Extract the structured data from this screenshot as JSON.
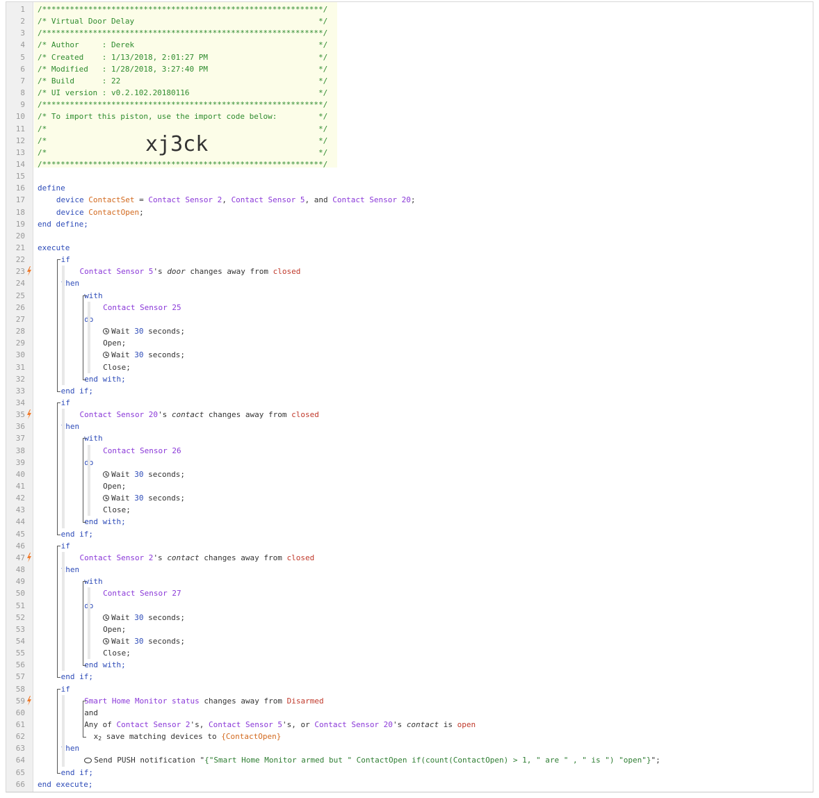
{
  "lines": [
    {
      "segs": [
        {
          "t": "/*************************************************************/",
          "c": "com"
        }
      ]
    },
    {
      "segs": [
        {
          "t": "/* Virtual Door Delay                                        */",
          "c": "com"
        }
      ]
    },
    {
      "segs": [
        {
          "t": "/*************************************************************/",
          "c": "com"
        }
      ]
    },
    {
      "segs": [
        {
          "t": "/* Author     : Derek                                        */",
          "c": "com"
        }
      ]
    },
    {
      "segs": [
        {
          "t": "/* Created    : 1/13/2018, 2:01:27 PM                        */",
          "c": "com"
        }
      ]
    },
    {
      "segs": [
        {
          "t": "/* Modified   : 1/28/2018, 3:27:40 PM                        */",
          "c": "com"
        }
      ]
    },
    {
      "segs": [
        {
          "t": "/* Build      : 22                                           */",
          "c": "com"
        }
      ]
    },
    {
      "segs": [
        {
          "t": "/* UI version : v0.2.102.20180116                            */",
          "c": "com"
        }
      ]
    },
    {
      "segs": [
        {
          "t": "/*************************************************************/",
          "c": "com"
        }
      ]
    },
    {
      "segs": [
        {
          "t": "/* To import this piston, use the import code below:         */",
          "c": "com"
        }
      ]
    },
    {
      "segs": [
        {
          "t": "/*                                                           */",
          "c": "com"
        }
      ]
    },
    {
      "segs": [
        {
          "t": "/*                                                           */",
          "c": "com"
        }
      ]
    },
    {
      "segs": [
        {
          "t": "/*                                                           */",
          "c": "com"
        }
      ]
    },
    {
      "segs": [
        {
          "t": "/*************************************************************/",
          "c": "com"
        }
      ]
    },
    {
      "segs": []
    },
    {
      "segs": [
        {
          "t": "define",
          "c": "kw"
        }
      ]
    },
    {
      "indent": 4,
      "segs": [
        {
          "t": "device ",
          "c": "kw"
        },
        {
          "t": "ContactSet",
          "c": "var"
        },
        {
          "t": " = ",
          "c": "txt"
        },
        {
          "t": "Contact Sensor 2",
          "c": "dev"
        },
        {
          "t": ", ",
          "c": "txt"
        },
        {
          "t": "Contact Sensor 5",
          "c": "dev"
        },
        {
          "t": ", and ",
          "c": "txt"
        },
        {
          "t": "Contact Sensor 20",
          "c": "dev"
        },
        {
          "t": ";",
          "c": "txt"
        }
      ]
    },
    {
      "indent": 4,
      "segs": [
        {
          "t": "device ",
          "c": "kw"
        },
        {
          "t": "ContactOpen",
          "c": "var"
        },
        {
          "t": ";",
          "c": "txt"
        }
      ]
    },
    {
      "segs": [
        {
          "t": "end define;",
          "c": "kw"
        }
      ]
    },
    {
      "segs": []
    },
    {
      "segs": [
        {
          "t": "execute",
          "c": "kw"
        }
      ]
    },
    {
      "indent": 5,
      "segs": [
        {
          "t": "if",
          "c": "kw"
        }
      ]
    },
    {
      "indent": 9,
      "bolt": true,
      "segs": [
        {
          "t": "Contact Sensor 5",
          "c": "dev"
        },
        {
          "t": "'s ",
          "c": "txt"
        },
        {
          "t": "door",
          "c": "it"
        },
        {
          "t": " changes away from ",
          "c": "txt"
        },
        {
          "t": "closed",
          "c": "val"
        }
      ]
    },
    {
      "indent": 5,
      "segs": [
        {
          "t": "then",
          "c": "kw"
        }
      ]
    },
    {
      "indent": 10,
      "segs": [
        {
          "t": "with",
          "c": "kw"
        }
      ]
    },
    {
      "indent": 14,
      "segs": [
        {
          "t": "Contact Sensor 25",
          "c": "dev"
        }
      ]
    },
    {
      "indent": 10,
      "segs": [
        {
          "t": "do",
          "c": "kw"
        }
      ]
    },
    {
      "indent": 14,
      "clock": true,
      "segs": [
        {
          "t": "Wait ",
          "c": "txt"
        },
        {
          "t": "30",
          "c": "num"
        },
        {
          "t": " seconds;",
          "c": "txt"
        }
      ]
    },
    {
      "indent": 14,
      "segs": [
        {
          "t": "Open;",
          "c": "txt"
        }
      ]
    },
    {
      "indent": 14,
      "clock": true,
      "segs": [
        {
          "t": "Wait ",
          "c": "txt"
        },
        {
          "t": "30",
          "c": "num"
        },
        {
          "t": " seconds;",
          "c": "txt"
        }
      ]
    },
    {
      "indent": 14,
      "segs": [
        {
          "t": "Close;",
          "c": "txt"
        }
      ]
    },
    {
      "indent": 10,
      "segs": [
        {
          "t": "end with;",
          "c": "kw"
        }
      ]
    },
    {
      "indent": 5,
      "segs": [
        {
          "t": "end if;",
          "c": "kw"
        }
      ]
    },
    {
      "indent": 5,
      "segs": [
        {
          "t": "if",
          "c": "kw"
        }
      ]
    },
    {
      "indent": 9,
      "bolt": true,
      "segs": [
        {
          "t": "Contact Sensor 20",
          "c": "dev"
        },
        {
          "t": "'s ",
          "c": "txt"
        },
        {
          "t": "contact",
          "c": "it"
        },
        {
          "t": " changes away from ",
          "c": "txt"
        },
        {
          "t": "closed",
          "c": "val"
        }
      ]
    },
    {
      "indent": 5,
      "segs": [
        {
          "t": "then",
          "c": "kw"
        }
      ]
    },
    {
      "indent": 10,
      "segs": [
        {
          "t": "with",
          "c": "kw"
        }
      ]
    },
    {
      "indent": 14,
      "segs": [
        {
          "t": "Contact Sensor 26",
          "c": "dev"
        }
      ]
    },
    {
      "indent": 10,
      "segs": [
        {
          "t": "do",
          "c": "kw"
        }
      ]
    },
    {
      "indent": 14,
      "clock": true,
      "segs": [
        {
          "t": "Wait ",
          "c": "txt"
        },
        {
          "t": "30",
          "c": "num"
        },
        {
          "t": " seconds;",
          "c": "txt"
        }
      ]
    },
    {
      "indent": 14,
      "segs": [
        {
          "t": "Open;",
          "c": "txt"
        }
      ]
    },
    {
      "indent": 14,
      "clock": true,
      "segs": [
        {
          "t": "Wait ",
          "c": "txt"
        },
        {
          "t": "30",
          "c": "num"
        },
        {
          "t": " seconds;",
          "c": "txt"
        }
      ]
    },
    {
      "indent": 14,
      "segs": [
        {
          "t": "Close;",
          "c": "txt"
        }
      ]
    },
    {
      "indent": 10,
      "segs": [
        {
          "t": "end with;",
          "c": "kw"
        }
      ]
    },
    {
      "indent": 5,
      "segs": [
        {
          "t": "end if;",
          "c": "kw"
        }
      ]
    },
    {
      "indent": 5,
      "segs": [
        {
          "t": "if",
          "c": "kw"
        }
      ]
    },
    {
      "indent": 9,
      "bolt": true,
      "segs": [
        {
          "t": "Contact Sensor 2",
          "c": "dev"
        },
        {
          "t": "'s ",
          "c": "txt"
        },
        {
          "t": "contact",
          "c": "it"
        },
        {
          "t": " changes away from ",
          "c": "txt"
        },
        {
          "t": "closed",
          "c": "val"
        }
      ]
    },
    {
      "indent": 5,
      "segs": [
        {
          "t": "then",
          "c": "kw"
        }
      ]
    },
    {
      "indent": 10,
      "segs": [
        {
          "t": "with",
          "c": "kw"
        }
      ]
    },
    {
      "indent": 14,
      "segs": [
        {
          "t": "Contact Sensor 27",
          "c": "dev"
        }
      ]
    },
    {
      "indent": 10,
      "segs": [
        {
          "t": "do",
          "c": "kw"
        }
      ]
    },
    {
      "indent": 14,
      "clock": true,
      "segs": [
        {
          "t": "Wait ",
          "c": "txt"
        },
        {
          "t": "30",
          "c": "num"
        },
        {
          "t": " seconds;",
          "c": "txt"
        }
      ]
    },
    {
      "indent": 14,
      "segs": [
        {
          "t": "Open;",
          "c": "txt"
        }
      ]
    },
    {
      "indent": 14,
      "clock": true,
      "segs": [
        {
          "t": "Wait ",
          "c": "txt"
        },
        {
          "t": "30",
          "c": "num"
        },
        {
          "t": " seconds;",
          "c": "txt"
        }
      ]
    },
    {
      "indent": 14,
      "segs": [
        {
          "t": "Close;",
          "c": "txt"
        }
      ]
    },
    {
      "indent": 10,
      "segs": [
        {
          "t": "end with;",
          "c": "kw"
        }
      ]
    },
    {
      "indent": 5,
      "segs": [
        {
          "t": "end if;",
          "c": "kw"
        }
      ]
    },
    {
      "indent": 5,
      "segs": [
        {
          "t": "if",
          "c": "kw"
        }
      ]
    },
    {
      "indent": 10,
      "bolt": true,
      "segs": [
        {
          "t": "Smart Home Monitor status",
          "c": "dev"
        },
        {
          "t": " changes away from ",
          "c": "txt"
        },
        {
          "t": "Disarmed",
          "c": "val"
        }
      ]
    },
    {
      "indent": 10,
      "segs": [
        {
          "t": "and",
          "c": "txt"
        }
      ]
    },
    {
      "indent": 10,
      "segs": [
        {
          "t": "Any of ",
          "c": "txt"
        },
        {
          "t": "Contact Sensor 2",
          "c": "dev"
        },
        {
          "t": "'s, ",
          "c": "txt"
        },
        {
          "t": "Contact Sensor 5",
          "c": "dev"
        },
        {
          "t": "'s, or ",
          "c": "txt"
        },
        {
          "t": "Contact Sensor 20",
          "c": "dev"
        },
        {
          "t": "'s ",
          "c": "txt"
        },
        {
          "t": "contact",
          "c": "it"
        },
        {
          "t": " is ",
          "c": "txt"
        },
        {
          "t": "open",
          "c": "val"
        }
      ]
    },
    {
      "indent": 12,
      "segs": [
        {
          "t": "x",
          "c": "txt"
        },
        {
          "t": "2",
          "c": "sub"
        },
        {
          "t": " save matching devices to ",
          "c": "txt"
        },
        {
          "t": "{ContactOpen}",
          "c": "var"
        }
      ]
    },
    {
      "indent": 5,
      "segs": [
        {
          "t": "then",
          "c": "kw"
        }
      ]
    },
    {
      "indent": 10,
      "bubble": true,
      "segs": [
        {
          "t": "Send PUSH notification \"",
          "c": "txt"
        },
        {
          "t": "{\"Smart Home Monitor armed but \" ContactOpen if(count(ContactOpen) > 1, \" are \" , \" is \") \"open\"}",
          "c": "str"
        },
        {
          "t": "\";",
          "c": "txt"
        }
      ]
    },
    {
      "indent": 5,
      "segs": [
        {
          "t": "end if;",
          "c": "kw"
        }
      ]
    },
    {
      "segs": [
        {
          "t": "end execute;",
          "c": "kw"
        }
      ]
    }
  ],
  "import_code": "xj3ck"
}
